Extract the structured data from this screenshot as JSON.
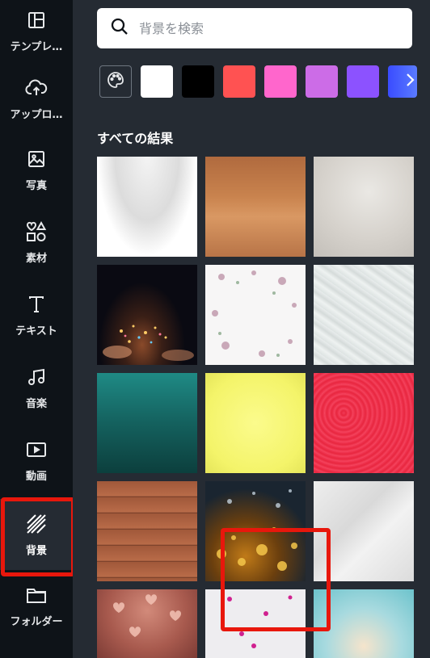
{
  "sidebar": {
    "items": [
      {
        "label": "テンプレ…",
        "icon": "template-icon"
      },
      {
        "label": "アップロ…",
        "icon": "upload-cloud-icon"
      },
      {
        "label": "写真",
        "icon": "photo-icon"
      },
      {
        "label": "素材",
        "icon": "elements-icon"
      },
      {
        "label": "テキスト",
        "icon": "text-icon"
      },
      {
        "label": "音楽",
        "icon": "music-icon"
      },
      {
        "label": "動画",
        "icon": "video-icon"
      },
      {
        "label": "背景",
        "icon": "background-icon"
      },
      {
        "label": "フォルダー",
        "icon": "folder-icon"
      }
    ],
    "active_index": 7
  },
  "search": {
    "placeholder": "背景を検索"
  },
  "colors": {
    "swatches": [
      "#ffffff",
      "#000000",
      "#ff5252",
      "#ff66cc",
      "#cc6ce7",
      "#8c52ff"
    ],
    "highlight": "#e8170c"
  },
  "results": {
    "title": "すべての結果",
    "tiles": [
      "white-gradient",
      "wood-orange",
      "grey-texture",
      "bokeh-lights-hands",
      "white-flowers",
      "white-paper-crumpled",
      "teal-gradient",
      "yellow-paper",
      "red-leather",
      "wood-planks",
      "golden-bokeh",
      "marble",
      "heart-bokeh",
      "pink-stars",
      "teal-bokeh"
    ],
    "selected_index": 7
  }
}
